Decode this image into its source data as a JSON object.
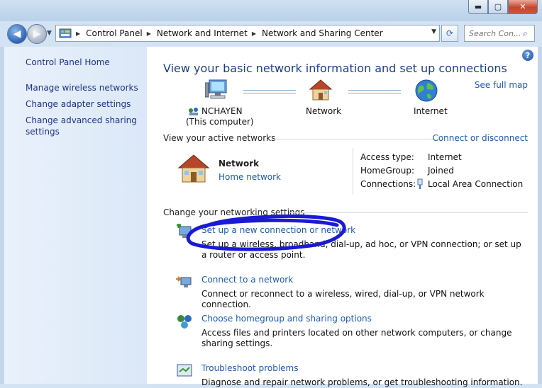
{
  "window": {
    "minimize_label": "▬",
    "maximize_label": "▢",
    "close_label": "✕"
  },
  "address": {
    "crumbs": [
      "Control Panel",
      "Network and Internet",
      "Network and Sharing Center"
    ],
    "search_placeholder": "Search Con..."
  },
  "sidebar": {
    "home": "Control Panel Home",
    "items": [
      {
        "label": "Manage wireless networks"
      },
      {
        "label": "Change adapter settings"
      },
      {
        "label": "Change advanced sharing settings"
      }
    ]
  },
  "main": {
    "heading": "View your basic network information and set up connections",
    "see_full_map": "See full map",
    "map": {
      "computer_name": "NCHAYEN",
      "computer_sub": "(This computer)",
      "network": "Network",
      "internet": "Internet"
    },
    "active": {
      "label": "View your active networks",
      "connect_disconnect": "Connect or disconnect",
      "network_name": "Network",
      "network_type": "Home network",
      "access_type_label": "Access type:",
      "access_type_value": "Internet",
      "homegroup_label": "HomeGroup:",
      "homegroup_value": "Joined",
      "connections_label": "Connections:",
      "connections_value": "Local Area Connection"
    },
    "change_label": "Change your networking settings",
    "tasks": [
      {
        "title": "Set up a new connection or network",
        "desc": "Set up a wireless, broadband, dial-up, ad hoc, or VPN connection; or set up a router or access point."
      },
      {
        "title": "Connect to a network",
        "desc": "Connect or reconnect to a wireless, wired, dial-up, or VPN network connection."
      },
      {
        "title": "Choose homegroup and sharing options",
        "desc": "Access files and printers located on other network computers, or change sharing settings."
      },
      {
        "title": "Troubleshoot problems",
        "desc": "Diagnose and repair network problems, or get troubleshooting information."
      }
    ]
  },
  "colors": {
    "link": "#1e5bb0",
    "heading": "#1d3f8a",
    "sidebar_link": "#1e3287",
    "annotation_stroke": "#1a1ad4"
  }
}
